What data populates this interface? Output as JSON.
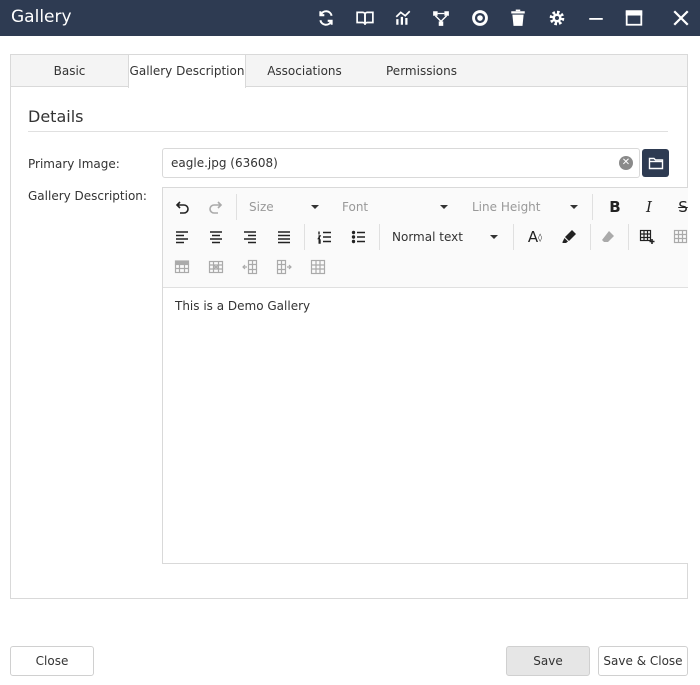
{
  "window": {
    "title": "Gallery",
    "title_bar_color": "#2e3b52",
    "icons": [
      "refresh-icon",
      "book-icon",
      "chart-icon",
      "hierarchy-icon",
      "cog-badge-icon",
      "trash-icon",
      "gear-icon",
      "minimize-icon",
      "maximize-icon",
      "close-icon"
    ]
  },
  "tabs": [
    {
      "label": "Basic",
      "active": false
    },
    {
      "label": "Gallery Description",
      "active": true
    },
    {
      "label": "Associations",
      "active": false
    },
    {
      "label": "Permissions",
      "active": false
    }
  ],
  "section": {
    "title": "Details"
  },
  "form": {
    "primary_image_label": "Primary Image:",
    "primary_image_value": "eagle.jpg (63608)",
    "gallery_description_label": "Gallery Description:"
  },
  "editor": {
    "size_placeholder": "Size",
    "font_placeholder": "Font",
    "line_height_placeholder": "Line Height",
    "paragraph_format": "Normal text",
    "content": "This is a Demo Gallery"
  },
  "footer": {
    "close_label": "Close",
    "save_label": "Save",
    "save_close_label": "Save & Close"
  }
}
